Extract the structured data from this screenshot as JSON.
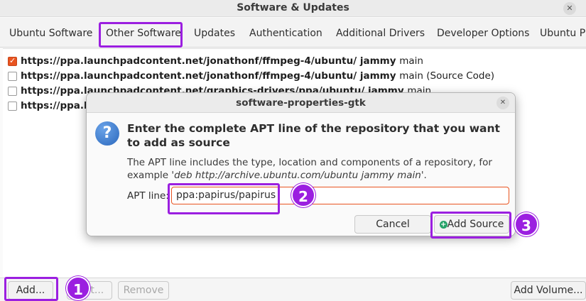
{
  "window": {
    "title": "Software & Updates"
  },
  "tabs": [
    {
      "label": "Ubuntu Software"
    },
    {
      "label": "Other Software"
    },
    {
      "label": "Updates"
    },
    {
      "label": "Authentication"
    },
    {
      "label": "Additional Drivers"
    },
    {
      "label": "Developer Options"
    },
    {
      "label": "Ubuntu Pr"
    }
  ],
  "sources": [
    {
      "checked": true,
      "url": "https://ppa.launchpadcontent.net/jonathonf/ffmpeg-4/ubuntu/ jammy",
      "rest": "main"
    },
    {
      "checked": false,
      "url": "https://ppa.launchpadcontent.net/jonathonf/ffmpeg-4/ubuntu/ jammy",
      "rest": "main (Source Code)"
    },
    {
      "checked": false,
      "url": "https://ppa.launchpadcontent.net/graphics-drivers/ppa/ubuntu/ jammy",
      "rest": "main"
    },
    {
      "checked": false,
      "url": "https://ppa.la",
      "rest": ""
    }
  ],
  "bottom": {
    "add_label": "Add...",
    "edit_label": "Edit...",
    "remove_label": "Remove",
    "add_volume_label": "Add Volume..."
  },
  "dialog": {
    "title": "software-properties-gtk",
    "heading": "Enter the complete APT line of the repository that you want to add as source",
    "desc_prefix": "The APT line includes the type, location and components of a repository, for example  '",
    "desc_example": "deb http://archive.ubuntu.com/ubuntu jammy main",
    "desc_suffix": "'.",
    "apt_label": "APT line:",
    "apt_value": "ppa:papirus/papirus",
    "cancel_label": "Cancel",
    "add_source_label": "Add Source"
  },
  "callouts": [
    "1",
    "2",
    "3"
  ],
  "colors": {
    "highlight": "#9b1fe0",
    "accent": "#e95420",
    "confirm": "#26a269"
  }
}
